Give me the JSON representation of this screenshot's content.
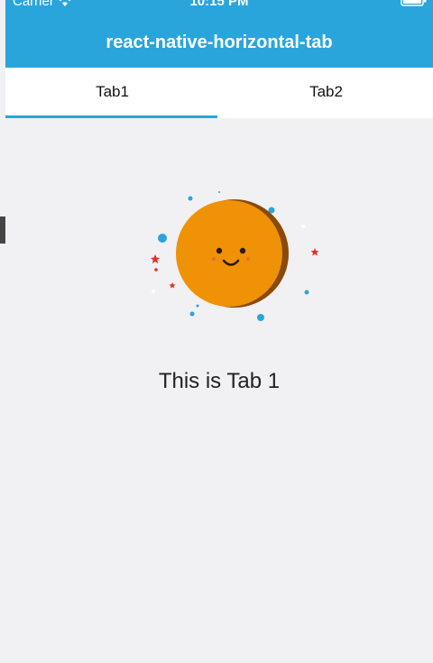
{
  "status_bar": {
    "carrier": "Carrier",
    "time": "10:15 PM"
  },
  "nav": {
    "title": "react-native-horizontal-tab"
  },
  "tabs": [
    {
      "label": "Tab1",
      "active": true
    },
    {
      "label": "Tab2",
      "active": false
    }
  ],
  "content": {
    "message": "This is Tab 1",
    "illustration": "smiling-planet-icon"
  },
  "colors": {
    "header": "#2aa5dc",
    "indicator": "#2aa5dc",
    "background": "#f1f0f2",
    "planet": "#ef9205",
    "planet_shadow": "#8a4a06"
  }
}
